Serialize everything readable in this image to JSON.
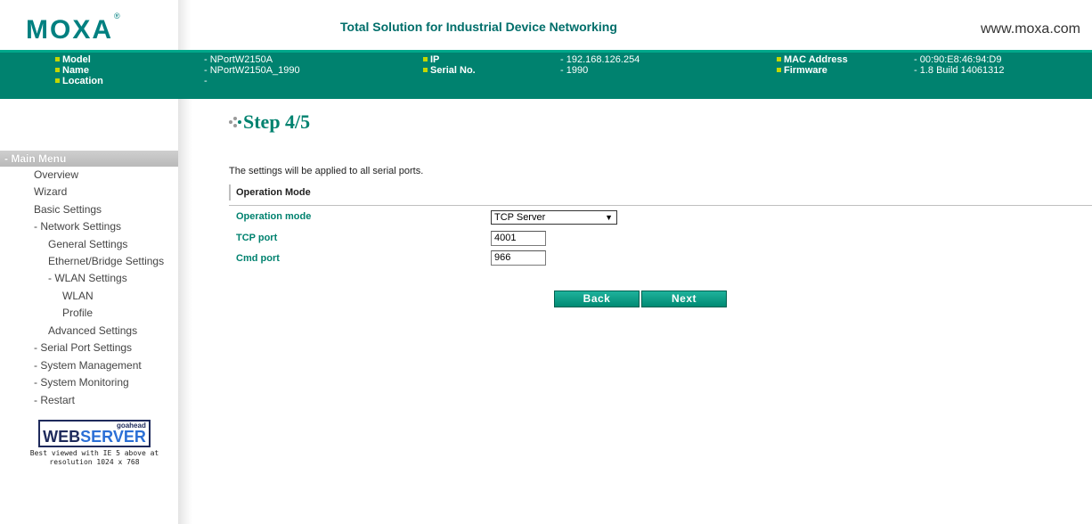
{
  "brand": {
    "logo": "MOXA",
    "logo_mark": "®",
    "tagline": "Total Solution for Industrial Device Networking",
    "site": "www.moxa.com"
  },
  "device_info": {
    "model_label": "Model",
    "model_value": "- NPortW2150A",
    "name_label": "Name",
    "name_value": "- NPortW2150A_1990",
    "location_label": "Location",
    "location_value": "-",
    "ip_label": "IP",
    "ip_value": "- 192.168.126.254",
    "serial_label": "Serial No.",
    "serial_value": "- 1990",
    "mac_label": "MAC Address",
    "mac_value": "- 00:90:E8:46:94:D9",
    "firmware_label": "Firmware",
    "firmware_value": "- 1.8 Build 14061312"
  },
  "sidebar": {
    "menu_title": "- Main Menu",
    "items": [
      {
        "label": "Overview"
      },
      {
        "label": "Wizard"
      },
      {
        "label": "Basic Settings"
      },
      {
        "label": "- Network Settings"
      },
      {
        "label": "General Settings"
      },
      {
        "label": "Ethernet/Bridge Settings"
      },
      {
        "label": "- WLAN Settings"
      },
      {
        "label": "WLAN"
      },
      {
        "label": "Profile"
      },
      {
        "label": "Advanced Settings"
      },
      {
        "label": "- Serial Port Settings"
      },
      {
        "label": "- System Management"
      },
      {
        "label": "- System Monitoring"
      },
      {
        "label": "- Restart"
      }
    ],
    "webserver": {
      "goahead": "goahead",
      "web": "WEB",
      "server": "SERVER",
      "note_line1": "Best viewed with IE 5 above at",
      "note_line2": "resolution 1024 x 768"
    }
  },
  "main": {
    "step_title": "Step 4/5",
    "note": "The settings will be applied to all serial ports.",
    "section_title": "Operation Mode",
    "operation_mode_label": "Operation mode",
    "operation_mode_value": "TCP Server",
    "tcp_port_label": "TCP port",
    "tcp_port_value": "4001",
    "cmd_port_label": "Cmd port",
    "cmd_port_value": "966",
    "back_label": "Back",
    "next_label": "Next"
  },
  "colors": {
    "brand_teal": "#00826f",
    "accent_square": "#c3d600",
    "label_green": "#00826f"
  }
}
